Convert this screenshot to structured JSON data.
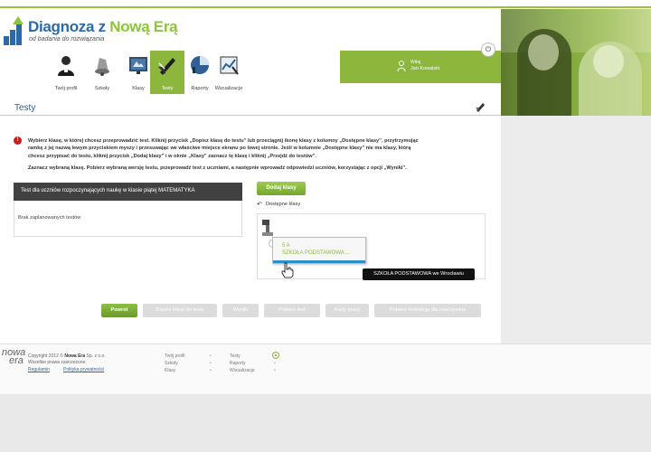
{
  "brand": {
    "title_a": "Diagnoza z ",
    "title_b": "Nową Erą",
    "subtitle": "od badania do rozwiązania"
  },
  "nav": {
    "items": [
      {
        "label": "Twój profil",
        "icon": "user-icon"
      },
      {
        "label": "Szkoły",
        "icon": "school-bell-icon"
      },
      {
        "label": "Klasy",
        "icon": "classroom-icon"
      },
      {
        "label": "Testy",
        "icon": "test-pen-icon"
      },
      {
        "label": "Raporty",
        "icon": "report-chart-icon"
      },
      {
        "label": "Wizualizacje",
        "icon": "visualization-icon"
      }
    ],
    "active_index": 3
  },
  "user": {
    "greeting": "Witaj",
    "name": "Jan Kowalski"
  },
  "page": {
    "title": "Testy"
  },
  "instructions": {
    "line1": "Wybierz klasę, w której chcesz przeprowadzić test. Kliknij przycisk „Dopisz klasę do testu” lub przeciągnij ikonę klasy z kolumny „Dostępne klasy”, przytrzymując",
    "line2": "ramkę z jej nazwą lewym przyciskiem myszy i przesuwając we właściwe miejsce ekranu po lewej stronie. Jeśli w kolumnie „Dostępne klasy” nie ma klasy, którą",
    "line3": "chcesz przypisać do testu, kliknij przycisk „Dodaj klasy” i w oknie „Klasy” zaznacz tę klasę i kliknij „Przejdź do testów”.",
    "line4": "Zaznacz wybraną klasę. Pobierz wybraną wersję testu, przeprowadź test z uczniami, a następnie wprowadź odpowiedzi uczniów, korzystając z opcji „Wyniki”."
  },
  "test_panel": {
    "header": "Test dla uczniów rozpoczynających naukę w klasie piątej MATEMATYKA",
    "empty_text": "Brak zaplanowanych testów"
  },
  "classes_panel": {
    "add_button": "Dodaj klasy",
    "label": "Dostępne klasy",
    "class_card": {
      "name": "5 A",
      "school": "SZKOŁA PODSTAWOWA ..."
    },
    "tooltip": "SZKOŁA PODSTAWOWA we Wrocławiu"
  },
  "actions": {
    "back": "Powrót",
    "assign": "Dopisz klasę do testu",
    "results": "Wyniki",
    "download": "Pobierz test",
    "work_sheets": "Karty pracy",
    "details": "Pobierz instrukcję dla nauczyciela"
  },
  "footer": {
    "logo_top": "nowa",
    "logo_bottom": "era",
    "copyright_a": "Copyright 2012 © ",
    "copyright_brand": "Nowa Era",
    "copyright_b": " Sp. z o.o.",
    "rights": "Wszelkie prawa zastrzeżone.",
    "link_rules": "Regulamin",
    "link_privacy": "Polityka prywatności",
    "nav_col1": [
      "Twój profil",
      "Szkoły",
      "Klasy"
    ],
    "nav_col2": [
      "Testy",
      "Raporty",
      "Wizualizacje"
    ]
  },
  "colors": {
    "accent_green": "#8cb63c",
    "brand_blue": "#2b6aa8",
    "header_dark": "#414141",
    "alert_red": "#c81e1e"
  }
}
